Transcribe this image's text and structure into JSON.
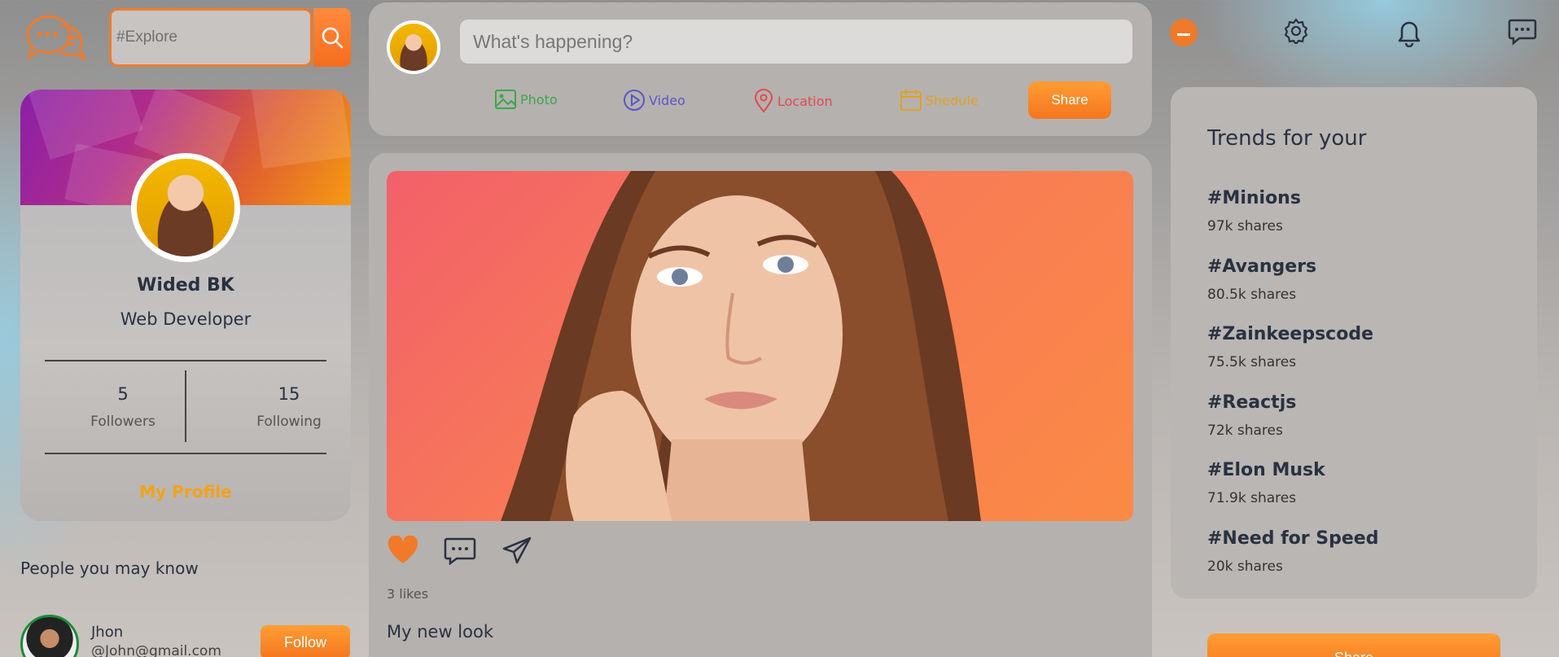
{
  "search": {
    "placeholder": "#Explore"
  },
  "profile": {
    "name": "Wided BK",
    "role": "Web Developer",
    "followers_count": "5",
    "followers_label": "Followers",
    "following_count": "15",
    "following_label": "Following",
    "my_profile_link": "My Profile"
  },
  "people": {
    "title": "People you may know",
    "items": [
      {
        "name": "Jhon",
        "handle": "@John@gmail.com",
        "follow_label": "Follow"
      }
    ]
  },
  "composer": {
    "placeholder": "What's happening?",
    "options": [
      {
        "label": "Photo",
        "icon": "photo-icon",
        "color": "#3aa84a"
      },
      {
        "label": "Video",
        "icon": "video-icon",
        "color": "#5b55c9"
      },
      {
        "label": "Location",
        "icon": "location-icon",
        "color": "#e2494f"
      },
      {
        "label": "Shedule",
        "icon": "calendar-icon",
        "color": "#e0a21f"
      }
    ],
    "share_label": "Share"
  },
  "post": {
    "likes": "3 likes",
    "caption": "My new look"
  },
  "trends": {
    "title": "Trends for your",
    "items": [
      {
        "tag": "#Minions",
        "shares": "97k shares"
      },
      {
        "tag": "#Avangers",
        "shares": "80.5k shares"
      },
      {
        "tag": "#Zainkeepscode",
        "shares": "75.5k shares"
      },
      {
        "tag": "#Reactjs",
        "shares": "72k shares"
      },
      {
        "tag": "#Elon Musk",
        "shares": "71.9k shares"
      },
      {
        "tag": "#Need for Speed",
        "shares": "20k shares"
      }
    ],
    "bottom_button": "Share"
  },
  "colors": {
    "accent": "#f5761f",
    "highlight": "#f3a21a",
    "text_dark": "#2a3140"
  }
}
